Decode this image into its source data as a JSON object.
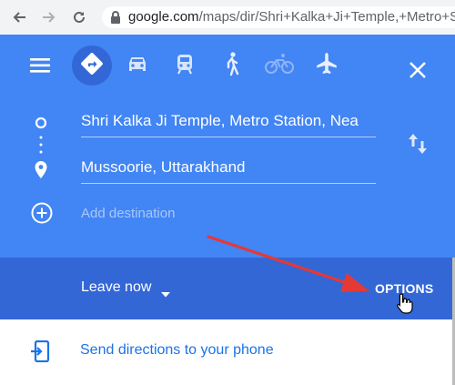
{
  "browser": {
    "url_host": "google.com",
    "url_path": "/maps/dir/Shri+Kalka+Ji+Temple,+Metro+Stati"
  },
  "travel_modes": [
    {
      "name": "best-route",
      "active": true
    },
    {
      "name": "driving"
    },
    {
      "name": "transit"
    },
    {
      "name": "walking"
    },
    {
      "name": "cycling"
    },
    {
      "name": "flights"
    }
  ],
  "directions": {
    "origin": "Shri Kalka Ji Temple, Metro Station, Nea",
    "destination": "Mussoorie, Uttarakhand",
    "add_destination_placeholder": "Add destination"
  },
  "options_bar": {
    "leave_now_label": "Leave now",
    "options_label": "OPTIONS"
  },
  "send": {
    "label": "Send directions to your phone"
  },
  "colors": {
    "panel_blue": "#4285f4",
    "options_blue": "#3367d6",
    "annotation_arrow": "#e53935",
    "link_blue": "#1a73e8"
  },
  "icons": [
    "back-arrow-icon",
    "forward-arrow-icon",
    "reload-icon",
    "lock-icon",
    "menu-icon",
    "directions-icon",
    "car-icon",
    "train-icon",
    "walk-icon",
    "bicycle-icon",
    "plane-icon",
    "close-icon",
    "origin-circle-icon",
    "route-dots-icon",
    "destination-pin-icon",
    "swap-icon",
    "add-destination-icon",
    "dropdown-caret-icon",
    "cursor-hand-icon",
    "send-to-phone-icon"
  ]
}
